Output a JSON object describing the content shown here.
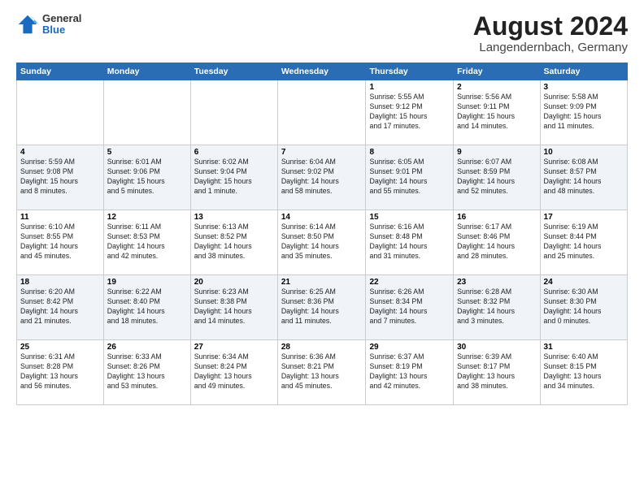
{
  "header": {
    "logo": {
      "general": "General",
      "blue": "Blue"
    },
    "title": "August 2024",
    "location": "Langendernbach, Germany"
  },
  "calendar": {
    "weekdays": [
      "Sunday",
      "Monday",
      "Tuesday",
      "Wednesday",
      "Thursday",
      "Friday",
      "Saturday"
    ],
    "weeks": [
      [
        {
          "day": "",
          "info": ""
        },
        {
          "day": "",
          "info": ""
        },
        {
          "day": "",
          "info": ""
        },
        {
          "day": "",
          "info": ""
        },
        {
          "day": "1",
          "info": "Sunrise: 5:55 AM\nSunset: 9:12 PM\nDaylight: 15 hours\nand 17 minutes."
        },
        {
          "day": "2",
          "info": "Sunrise: 5:56 AM\nSunset: 9:11 PM\nDaylight: 15 hours\nand 14 minutes."
        },
        {
          "day": "3",
          "info": "Sunrise: 5:58 AM\nSunset: 9:09 PM\nDaylight: 15 hours\nand 11 minutes."
        }
      ],
      [
        {
          "day": "4",
          "info": "Sunrise: 5:59 AM\nSunset: 9:08 PM\nDaylight: 15 hours\nand 8 minutes."
        },
        {
          "day": "5",
          "info": "Sunrise: 6:01 AM\nSunset: 9:06 PM\nDaylight: 15 hours\nand 5 minutes."
        },
        {
          "day": "6",
          "info": "Sunrise: 6:02 AM\nSunset: 9:04 PM\nDaylight: 15 hours\nand 1 minute."
        },
        {
          "day": "7",
          "info": "Sunrise: 6:04 AM\nSunset: 9:02 PM\nDaylight: 14 hours\nand 58 minutes."
        },
        {
          "day": "8",
          "info": "Sunrise: 6:05 AM\nSunset: 9:01 PM\nDaylight: 14 hours\nand 55 minutes."
        },
        {
          "day": "9",
          "info": "Sunrise: 6:07 AM\nSunset: 8:59 PM\nDaylight: 14 hours\nand 52 minutes."
        },
        {
          "day": "10",
          "info": "Sunrise: 6:08 AM\nSunset: 8:57 PM\nDaylight: 14 hours\nand 48 minutes."
        }
      ],
      [
        {
          "day": "11",
          "info": "Sunrise: 6:10 AM\nSunset: 8:55 PM\nDaylight: 14 hours\nand 45 minutes."
        },
        {
          "day": "12",
          "info": "Sunrise: 6:11 AM\nSunset: 8:53 PM\nDaylight: 14 hours\nand 42 minutes."
        },
        {
          "day": "13",
          "info": "Sunrise: 6:13 AM\nSunset: 8:52 PM\nDaylight: 14 hours\nand 38 minutes."
        },
        {
          "day": "14",
          "info": "Sunrise: 6:14 AM\nSunset: 8:50 PM\nDaylight: 14 hours\nand 35 minutes."
        },
        {
          "day": "15",
          "info": "Sunrise: 6:16 AM\nSunset: 8:48 PM\nDaylight: 14 hours\nand 31 minutes."
        },
        {
          "day": "16",
          "info": "Sunrise: 6:17 AM\nSunset: 8:46 PM\nDaylight: 14 hours\nand 28 minutes."
        },
        {
          "day": "17",
          "info": "Sunrise: 6:19 AM\nSunset: 8:44 PM\nDaylight: 14 hours\nand 25 minutes."
        }
      ],
      [
        {
          "day": "18",
          "info": "Sunrise: 6:20 AM\nSunset: 8:42 PM\nDaylight: 14 hours\nand 21 minutes."
        },
        {
          "day": "19",
          "info": "Sunrise: 6:22 AM\nSunset: 8:40 PM\nDaylight: 14 hours\nand 18 minutes."
        },
        {
          "day": "20",
          "info": "Sunrise: 6:23 AM\nSunset: 8:38 PM\nDaylight: 14 hours\nand 14 minutes."
        },
        {
          "day": "21",
          "info": "Sunrise: 6:25 AM\nSunset: 8:36 PM\nDaylight: 14 hours\nand 11 minutes."
        },
        {
          "day": "22",
          "info": "Sunrise: 6:26 AM\nSunset: 8:34 PM\nDaylight: 14 hours\nand 7 minutes."
        },
        {
          "day": "23",
          "info": "Sunrise: 6:28 AM\nSunset: 8:32 PM\nDaylight: 14 hours\nand 3 minutes."
        },
        {
          "day": "24",
          "info": "Sunrise: 6:30 AM\nSunset: 8:30 PM\nDaylight: 14 hours\nand 0 minutes."
        }
      ],
      [
        {
          "day": "25",
          "info": "Sunrise: 6:31 AM\nSunset: 8:28 PM\nDaylight: 13 hours\nand 56 minutes."
        },
        {
          "day": "26",
          "info": "Sunrise: 6:33 AM\nSunset: 8:26 PM\nDaylight: 13 hours\nand 53 minutes."
        },
        {
          "day": "27",
          "info": "Sunrise: 6:34 AM\nSunset: 8:24 PM\nDaylight: 13 hours\nand 49 minutes."
        },
        {
          "day": "28",
          "info": "Sunrise: 6:36 AM\nSunset: 8:21 PM\nDaylight: 13 hours\nand 45 minutes."
        },
        {
          "day": "29",
          "info": "Sunrise: 6:37 AM\nSunset: 8:19 PM\nDaylight: 13 hours\nand 42 minutes."
        },
        {
          "day": "30",
          "info": "Sunrise: 6:39 AM\nSunset: 8:17 PM\nDaylight: 13 hours\nand 38 minutes."
        },
        {
          "day": "31",
          "info": "Sunrise: 6:40 AM\nSunset: 8:15 PM\nDaylight: 13 hours\nand 34 minutes."
        }
      ]
    ]
  }
}
